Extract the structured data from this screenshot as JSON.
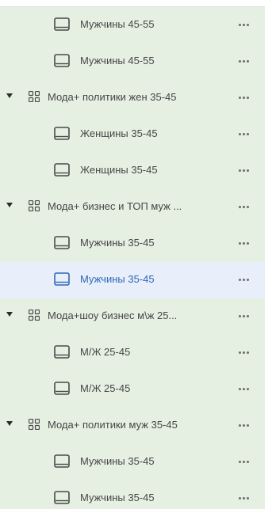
{
  "tree": {
    "rows": [
      {
        "type": "item",
        "label": "Мужчины 45-55",
        "selected": false
      },
      {
        "type": "item",
        "label": "Мужчины 45-55",
        "selected": false
      },
      {
        "type": "group",
        "label": "Мода+ политики жен 35-45",
        "selected": false
      },
      {
        "type": "item",
        "label": "Женщины 35-45",
        "selected": false
      },
      {
        "type": "item",
        "label": "Женщины 35-45",
        "selected": false
      },
      {
        "type": "group",
        "label": "Мода+ бизнес и ТОП муж ...",
        "selected": false
      },
      {
        "type": "item",
        "label": "Мужчины 35-45",
        "selected": false
      },
      {
        "type": "item",
        "label": "Мужчины 35-45",
        "selected": true
      },
      {
        "type": "group",
        "label": "Мода+шоу бизнес м\\ж 25...",
        "selected": false
      },
      {
        "type": "item",
        "label": "М/Ж 25-45",
        "selected": false
      },
      {
        "type": "item",
        "label": "М/Ж 25-45",
        "selected": false
      },
      {
        "type": "group",
        "label": "Мода+ политики муж 35-45",
        "selected": false
      },
      {
        "type": "item",
        "label": "Мужчины 35-45",
        "selected": false
      },
      {
        "type": "item",
        "label": "Мужчины 35-45",
        "selected": false
      }
    ]
  },
  "icons": {
    "group": "ad-set-grid-icon",
    "item": "ad-monitor-icon",
    "caret": "caret-down-icon",
    "more": "more-options-icon"
  },
  "colors": {
    "panel_background": "#e5efe2",
    "selected_background": "#e8eefa",
    "selected_text": "#2f69b8",
    "text": "#474747",
    "icon": "#4a4a4a"
  }
}
